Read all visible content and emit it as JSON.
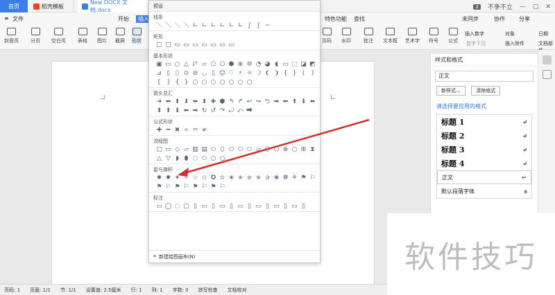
{
  "tabs": {
    "home": "首页",
    "template": "稻壳模板",
    "doc": "New DOCX 文档.docx"
  },
  "window": {
    "badge": "2",
    "user": "不争不立"
  },
  "menu": {
    "file": "文件",
    "start": "开始",
    "insert": "插入",
    "special": "特色功能",
    "find": "查找",
    "sync": "未同步",
    "collab": "协作",
    "share": "分享"
  },
  "toolbar": {
    "cover": "封面页",
    "paging": "分页",
    "blank": "空白页",
    "table": "表格",
    "picture": "图片",
    "screenshot": "截屏",
    "shape": "形状",
    "page_num": "页码",
    "watermark": "水印",
    "comment": "批注",
    "textbox": "文本框",
    "art": "艺术字",
    "symbol": "符号",
    "formula": "公式",
    "insert_num": "插入数字",
    "object": "对象",
    "date": "日期",
    "attach": "插入附件",
    "doc_part": "文档部件",
    "insert_link": "首字下沉"
  },
  "popup": {
    "title": "预设",
    "sections": [
      {
        "label": "线条",
        "shapes": [
          "＼",
          "＼",
          "＼",
          "＼",
          "∟",
          "∟",
          "∟",
          "∟",
          "∟",
          "∟",
          "∫",
          "∫",
          "∽"
        ]
      },
      {
        "label": "矩形",
        "shapes": [
          "□",
          "□",
          "▭",
          "▭",
          "▭",
          "▭",
          "▭",
          "▭",
          "▭"
        ]
      },
      {
        "label": "基本形状",
        "shapes": [
          "▣",
          "▭",
          "○",
          "△",
          "◸",
          "▱",
          "⬠",
          "⬡",
          "⬢",
          "⊕",
          "⑩",
          "◔",
          "◕",
          "◖",
          "▭",
          "⬚",
          "◪",
          "◩",
          "⊿",
          "▯",
          "⬯",
          "⊙",
          "⊘",
          "◡",
          "▯",
          "☺",
          "♡",
          "⚡",
          "☼",
          "☽",
          "❨",
          "❩",
          "{",
          "}",
          "(",
          ")",
          "[",
          "]",
          "{",
          "}",
          "○",
          "○",
          "○",
          "○",
          "○",
          "○",
          "○"
        ]
      },
      {
        "label": "箭头总汇",
        "shapes": [
          "➜",
          "⬅",
          "⬆",
          "⬇",
          "⬌",
          "⬍",
          "✚",
          "⬢",
          "↰",
          "↱",
          "↩",
          "↪",
          "⮌",
          "➡",
          "⬅",
          "⬆",
          "⬇",
          "⬌",
          "⬍",
          "⬆",
          "⬇",
          "⬅",
          "➡",
          "↻",
          "↺",
          "↷",
          "⤾",
          "⤺",
          "⮕"
        ]
      },
      {
        "label": "公式形状",
        "shapes": [
          "✚",
          "━",
          "✖",
          "÷",
          "＝",
          "≠"
        ]
      },
      {
        "label": "流程图",
        "shapes": [
          "□",
          "▭",
          "◇",
          "▱",
          "▥",
          "▤",
          "⬭",
          "⬯",
          "⬭",
          "⬭",
          "⬭",
          "▱",
          "⬡",
          "⬠",
          "⊗",
          "○",
          "⊞",
          "⧗",
          "△",
          "▽",
          "◗",
          "⬮",
          "◌",
          "⬭",
          "○",
          "○"
        ]
      },
      {
        "label": "星与旗帜",
        "shapes": [
          "✸",
          "✹",
          "✦",
          "✧",
          "☆",
          "✩",
          "✪",
          "✫",
          "✬",
          "✭",
          "✮",
          "✯",
          "✰",
          "❀",
          "❁",
          "⚘",
          "⚑",
          "⚐",
          "⚑",
          "⚐",
          "⚑",
          "⚐",
          "⚑",
          "⚐",
          "⚑",
          "⚐"
        ]
      },
      {
        "label": "标注",
        "shapes": [
          "▭",
          "◯",
          "◌",
          "▢",
          "▯",
          "▭",
          "▯",
          "▭",
          "▯",
          "▭",
          "▯",
          "▭",
          "▯",
          "▭",
          "▯",
          "▭",
          "▯"
        ]
      }
    ],
    "footer": "新建绘图画布(N)"
  },
  "panel": {
    "title": "样式和格式",
    "current": "正文",
    "new_style": "新样式...",
    "clear_format": "清除格式",
    "hint": "请选择要应用的格式",
    "styles": [
      "标题 1",
      "标题 2",
      "标题 3",
      "标题 4"
    ],
    "normal": "正文",
    "default_font": "默认段落字体"
  },
  "status": {
    "page_num": "页码: 1",
    "pages": "页面: 1/1",
    "section": "节: 1/1",
    "setting": "设置值: 2.5厘米",
    "row": "行: 1",
    "col": "列: 1",
    "words": "字数: 0",
    "spell": "拼写检查",
    "proof": "文档校对"
  },
  "watermark": "软件技巧"
}
